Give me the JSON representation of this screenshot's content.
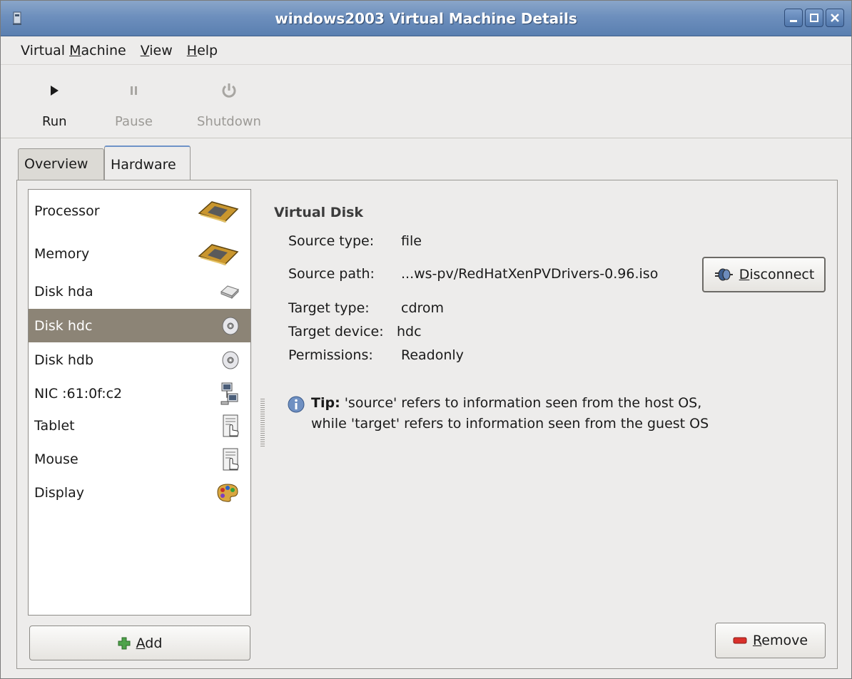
{
  "window": {
    "title": "windows2003 Virtual Machine Details"
  },
  "menubar": {
    "items": [
      {
        "pre": "Virtual ",
        "mnemonic": "M",
        "post": "achine"
      },
      {
        "pre": "",
        "mnemonic": "V",
        "post": "iew"
      },
      {
        "pre": "",
        "mnemonic": "H",
        "post": "elp"
      }
    ]
  },
  "toolbar": {
    "run_label": "Run",
    "pause_label": "Pause",
    "shutdown_label": "Shutdown"
  },
  "tabs": {
    "overview": "Overview",
    "hardware": "Hardware"
  },
  "hardware_list": [
    {
      "label": "Processor",
      "icon": "processor-icon"
    },
    {
      "label": "Memory",
      "icon": "memory-icon"
    },
    {
      "label": "Disk hda",
      "icon": "harddisk-icon"
    },
    {
      "label": "Disk hdc",
      "icon": "cdrom-icon",
      "selected": true
    },
    {
      "label": "Disk hdb",
      "icon": "cdrom-icon"
    },
    {
      "label": "NIC :61:0f:c2",
      "icon": "network-icon"
    },
    {
      "label": "Tablet",
      "icon": "input-device-icon"
    },
    {
      "label": "Mouse",
      "icon": "input-device-icon"
    },
    {
      "label": "Display",
      "icon": "display-palette-icon"
    }
  ],
  "details": {
    "title": "Virtual Disk",
    "fields": [
      {
        "label": "Source type:",
        "value": "file"
      },
      {
        "label": "Source path:",
        "value": "...ws-pv/RedHatXenPVDrivers-0.96.iso"
      },
      {
        "label": "Target type:",
        "value": "cdrom"
      },
      {
        "label": "Target device:",
        "value": "hdc"
      },
      {
        "label": "Permissions:",
        "value": "Readonly"
      }
    ],
    "disconnect": {
      "mnemonic": "D",
      "rest": "isconnect"
    },
    "tip_bold": "Tip:",
    "tip_line1": " 'source' refers to information seen from the host OS,",
    "tip_line2": "while 'target' refers to information seen from the guest OS"
  },
  "buttons": {
    "add": {
      "mnemonic": "A",
      "rest": "dd"
    },
    "remove": {
      "mnemonic": "R",
      "rest": "emove"
    }
  },
  "colors": {
    "selected_row": "#8c8476",
    "titlebar": "#6d8fbd"
  }
}
